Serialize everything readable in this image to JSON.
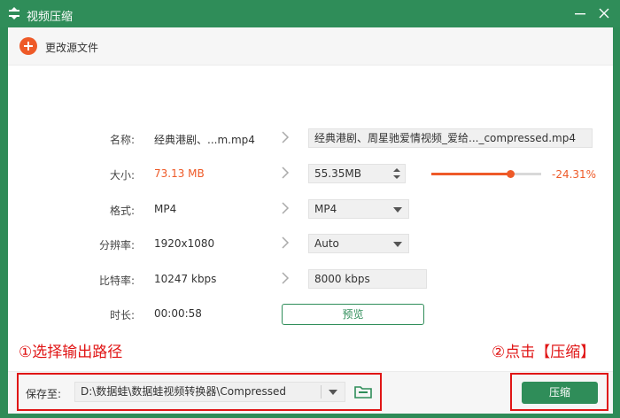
{
  "window": {
    "title": "视频压缩"
  },
  "topbar": {
    "change_source_label": "更改源文件"
  },
  "rows": {
    "name": {
      "label": "名称:",
      "value": "经典港剧、...m.mp4",
      "output": "经典港剧、周星驰爱情视频_爱给..._compressed.mp4"
    },
    "size": {
      "label": "大小:",
      "value": "73.13 MB",
      "output": "55.35MB",
      "percent": "-24.31%",
      "slider_fraction": 0.72
    },
    "format": {
      "label": "格式:",
      "value": "MP4",
      "selected": "MP4"
    },
    "resolution": {
      "label": "分辨率:",
      "value": "1920x1080",
      "selected": "Auto"
    },
    "bitrate": {
      "label": "比特率:",
      "value": "10247 kbps",
      "output": "8000 kbps"
    },
    "duration": {
      "label": "时长:",
      "value": "00:00:58"
    }
  },
  "preview_label": "预览",
  "annotations": {
    "left": "①选择输出路径",
    "right": "②点击【压缩】"
  },
  "bottom": {
    "save_label": "保存至:",
    "path": "D:\\数据蛙\\数据蛙视频转换器\\Compressed",
    "compress_label": "压缩"
  },
  "colors": {
    "accent_green": "#2f8d59",
    "accent_orange": "#ee5a28",
    "annotation_red": "#e01515"
  },
  "icons": [
    "app-icon",
    "minimize-icon",
    "close-icon",
    "add-icon",
    "chevron-right-icon",
    "spin-arrows-icon",
    "dropdown-caret-icon",
    "folder-icon"
  ]
}
